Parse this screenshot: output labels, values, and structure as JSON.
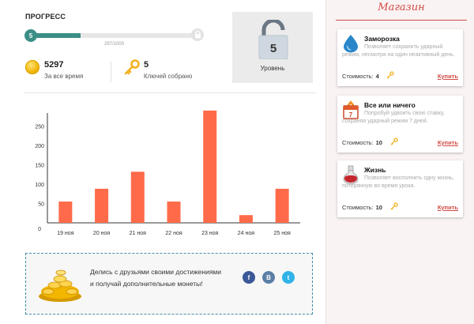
{
  "progress": {
    "title": "ПРОГРЕСС",
    "level_number": "5",
    "bar_count": "297/1000",
    "bar_fraction": 0.297
  },
  "stats": {
    "coins_value": "5297",
    "coins_label": "За все время",
    "keys_value": "5",
    "keys_label": "Ключей собрано"
  },
  "level_box": {
    "number": "5",
    "label": "Уровень"
  },
  "chart_data": {
    "type": "bar",
    "categories": [
      "19 ноя",
      "20 ноя",
      "21 ноя",
      "22 ноя",
      "23 ноя",
      "24 ноя",
      "25 ноя"
    ],
    "values": [
      55,
      88,
      132,
      55,
      290,
      20,
      88
    ],
    "y_ticks": [
      0,
      50,
      100,
      150,
      200,
      250
    ],
    "ylim": [
      0,
      300
    ],
    "bar_color": "#ff6b4a",
    "title": "",
    "xlabel": "",
    "ylabel": ""
  },
  "share": {
    "text_line1": "Делись с друзьями своими достижениями",
    "text_line2": "и получай дополнительные монеты!",
    "socials": [
      {
        "label": "f",
        "color": "#3b5998"
      },
      {
        "label": "В",
        "color": "#5b7fa6"
      },
      {
        "label": "t",
        "color": "#30b3e8"
      }
    ]
  },
  "shop": {
    "title": "Магазин",
    "cost_label": "Стоимость:",
    "buy_label": "Купить",
    "items": [
      {
        "title": "Заморозка",
        "desc": "Позволяет сохранить ударный режим, несмотря на один неактивный день.",
        "cost": "4",
        "icon": "water-drop-icon"
      },
      {
        "title": "Все или ничего",
        "desc": "Попробуй удвоить свою ставку, сохраняя ударный режим 7 дней.",
        "cost": "10",
        "icon": "calendar-icon"
      },
      {
        "title": "Жизнь",
        "desc": "Позволяет восполнить одну жизнь, потерянную во время урока.",
        "cost": "10",
        "icon": "potion-icon"
      }
    ]
  },
  "colors": {
    "accent_teal": "#3b8f86",
    "shop_red": "#d24a45",
    "bar_orange": "#ff6b4a"
  }
}
